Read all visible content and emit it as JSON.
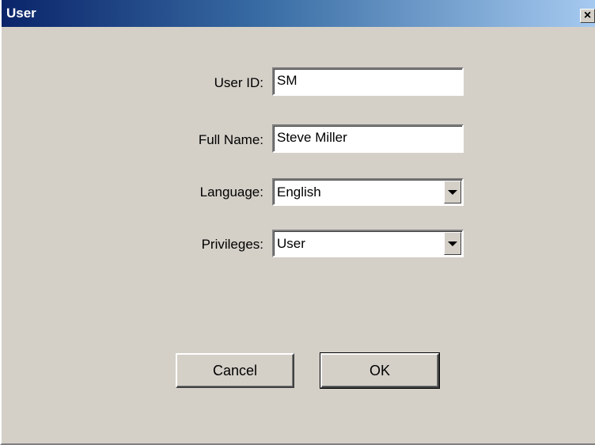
{
  "window": {
    "title": "User",
    "close_glyph": "×"
  },
  "form": {
    "user_id": {
      "label": "User ID:",
      "value": "SM"
    },
    "full_name": {
      "label": "Full Name:",
      "value": "Steve Miller"
    },
    "language": {
      "label": "Language:",
      "value": "English"
    },
    "privileges": {
      "label": "Privileges:",
      "value": "User"
    }
  },
  "buttons": {
    "cancel": "Cancel",
    "ok": "OK"
  },
  "icons": {
    "close": "close-icon",
    "dropdown": "chevron-down-icon"
  },
  "colors": {
    "titlebar_start": "#0a246a",
    "titlebar_end": "#a6caf0",
    "face": "#d4d0c8"
  }
}
